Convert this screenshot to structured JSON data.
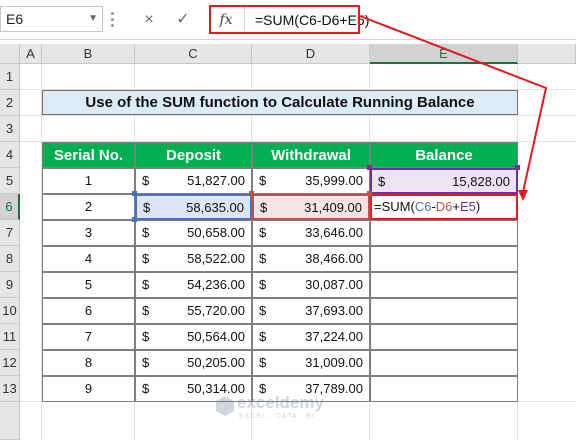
{
  "formula_bar": {
    "name_box": "E6",
    "cancel_icon": "×",
    "enter_icon": "✓",
    "fx_label": "fx",
    "formula": "=SUM(C6-D6+E5)"
  },
  "columns": [
    "A",
    "B",
    "C",
    "D",
    "E"
  ],
  "rows": [
    "1",
    "2",
    "3",
    "4",
    "5",
    "6",
    "7",
    "8",
    "9",
    "10",
    "11",
    "12",
    "13"
  ],
  "title": "Use of the SUM function to Calculate Running Balance",
  "headers": {
    "serial": "Serial No.",
    "deposit": "Deposit",
    "withdrawal": "Withdrawal",
    "balance": "Balance"
  },
  "currency": "$",
  "table": [
    {
      "serial": "1",
      "deposit": "51,827.00",
      "withdrawal": "35,999.00",
      "balance": "15,828.00"
    },
    {
      "serial": "2",
      "deposit": "58,635.00",
      "withdrawal": "31,409.00",
      "balance": ""
    },
    {
      "serial": "3",
      "deposit": "50,658.00",
      "withdrawal": "33,646.00",
      "balance": ""
    },
    {
      "serial": "4",
      "deposit": "58,522.00",
      "withdrawal": "38,466.00",
      "balance": ""
    },
    {
      "serial": "5",
      "deposit": "54,236.00",
      "withdrawal": "30,087.00",
      "balance": ""
    },
    {
      "serial": "6",
      "deposit": "55,720.00",
      "withdrawal": "37,693.00",
      "balance": ""
    },
    {
      "serial": "7",
      "deposit": "50,564.00",
      "withdrawal": "37,224.00",
      "balance": ""
    },
    {
      "serial": "8",
      "deposit": "50,205.00",
      "withdrawal": "31,009.00",
      "balance": ""
    },
    {
      "serial": "9",
      "deposit": "50,314.00",
      "withdrawal": "37,789.00",
      "balance": ""
    }
  ],
  "edit_formula": {
    "prefix": "=SUM(",
    "ref_c": "C6",
    "op1": "-",
    "ref_d": "D6",
    "op2": "+",
    "ref_e": "E5",
    "suffix": ")"
  },
  "watermark": {
    "name": "exceldemy",
    "tagline": "EXCEL · DATA · BI"
  },
  "colors": {
    "header_green": "#00b050",
    "title_blue": "#dcebf7",
    "highlight_red": "#e8191e",
    "ref_c": "#4472c4",
    "ref_d": "#c0504d",
    "ref_e": "#7030a0"
  }
}
